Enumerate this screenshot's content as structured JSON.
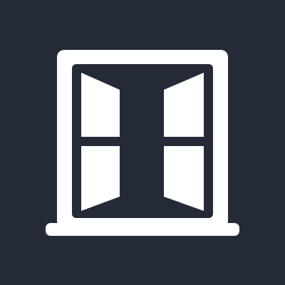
{
  "icon": {
    "name": "open-window-icon",
    "foreground_color": "#ffffff",
    "background_color": "#252a39"
  }
}
